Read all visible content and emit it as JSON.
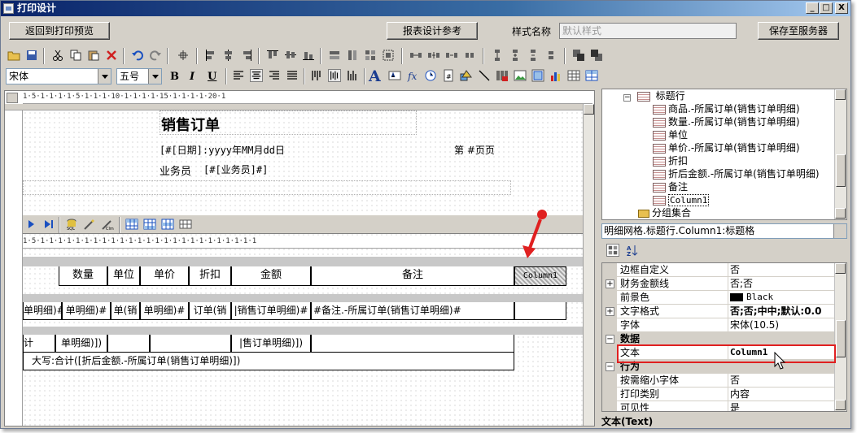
{
  "window": {
    "title": "打印设计"
  },
  "window_controls": {
    "minimize": "_",
    "maximize": "□",
    "close": "X"
  },
  "cmdbar": {
    "back_label": "返回到打印预览",
    "ref_label": "报表设计参考",
    "style_label": "样式名称",
    "style_placeholder": "默认样式",
    "save_label": "保存至服务器"
  },
  "format_bar": {
    "font_family": "宋体",
    "font_size": "五号",
    "bold": "B",
    "italic": "I",
    "underline": "U",
    "text_icon": "A"
  },
  "ruler": {
    "top": "1·5·1·1·1·1·5·1·1·1·10·1·1·1·1·15·1·1·1·1·20·1",
    "sub": "1·5·1·1·1·1·1·1·1·1·1·1·1·1·1·1·1·1·1·1·1·1·1·1·1·1·1"
  },
  "report": {
    "title": "销售订单",
    "date_field": "[#[日期]:yyyy年MM月dd日",
    "page_field": "第 #页页",
    "salesman_label": "业务员",
    "salesman_field": "[#[业务员]#]",
    "headers": [
      "数量",
      "单位",
      "单价",
      "折扣",
      "金额",
      "备注",
      "Column1"
    ],
    "detail": [
      "单明细)#",
      "单明细)#",
      "单(销",
      "单明细)#",
      "订单(销",
      "|销售订单明细)#",
      "#备注.-所属订单(销售订单明细)#",
      ""
    ],
    "summary": [
      "计",
      "单明细)])",
      "",
      "",
      "|售订单明细)])",
      ""
    ],
    "total_text": "大写:合计([折后金额.-所属订单(销售订单明细)])"
  },
  "sub_toolbar": {
    "icon_names": [
      "play-icon",
      "last-icon",
      "sql-icon",
      "wizard-icon",
      "chart-icon",
      "grid-icon-1",
      "grid-icon-2",
      "grid-icon-3",
      "grid-icon-4"
    ]
  },
  "tree": {
    "root": "标题行",
    "items": [
      "商品.-所属订单(销售订单明细)",
      "数量.-所属订单(销售订单明细)",
      "单位",
      "单价.-所属订单(销售订单明细)",
      "折扣",
      "折后金额.-所属订单(销售订单明细)",
      "备注",
      "Column1"
    ],
    "next_group": "分组集合"
  },
  "property_combo": "明细网格.标题行.Column1:标题格",
  "properties": [
    {
      "name": "边框自定义",
      "value": "否",
      "expand": false,
      "category": false
    },
    {
      "name": "财务金额线",
      "value": "否;否",
      "expand": true,
      "category": false
    },
    {
      "name": "前景色",
      "value": "Black",
      "expand": false,
      "category": false,
      "swatch": "#000000"
    },
    {
      "name": "文字格式",
      "value": "否;否;中中;默认:0.0",
      "expand": true,
      "category": false
    },
    {
      "name": "字体",
      "value": "宋体(10.5)",
      "expand": false,
      "category": false
    },
    {
      "name": "数据",
      "value": "",
      "expand": false,
      "category": true
    },
    {
      "name": "文本",
      "value": "Column1",
      "expand": false,
      "category": false
    },
    {
      "name": "行为",
      "value": "",
      "expand": false,
      "category": true
    },
    {
      "name": "按需缩小字体",
      "value": "否",
      "expand": false,
      "category": false
    },
    {
      "name": "打印类别",
      "value": "内容",
      "expand": false,
      "category": false
    },
    {
      "name": "可见性",
      "value": "是",
      "expand": false,
      "category": false
    }
  ],
  "description": "文本(Text)",
  "colors": {
    "accent_red": "#e02020",
    "title_blue": "#0a246a"
  }
}
